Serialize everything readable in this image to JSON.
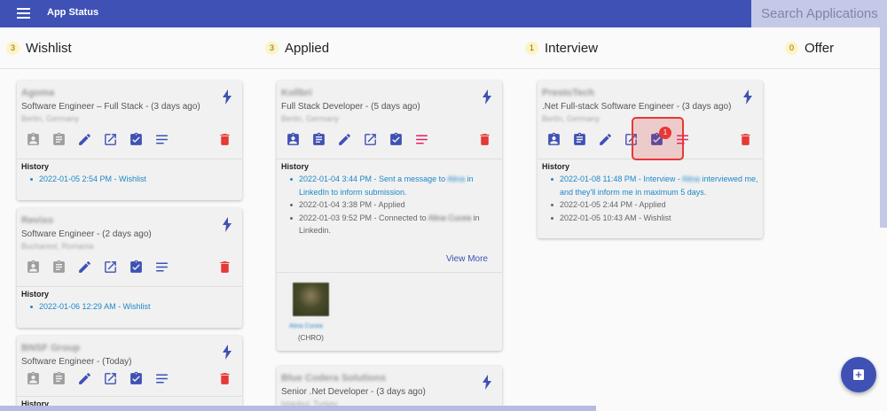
{
  "app": {
    "title": "App Status",
    "search_placeholder": "Search Applications"
  },
  "columns": [
    {
      "count": "3",
      "title": "Wishlist"
    },
    {
      "count": "3",
      "title": "Applied"
    },
    {
      "count": "1",
      "title": "Interview"
    },
    {
      "count": "0",
      "title": "Offer"
    }
  ],
  "history_label": "History",
  "colors": {
    "primary": "#3f51b5",
    "delete": "#e53935",
    "inactive_icon": "#9e9e9e",
    "notes_pink": "#e91e63",
    "history_link": "#1e88c8"
  },
  "wishlist": [
    {
      "company": "Agoma",
      "role": "Software Engineer – Full Stack - (3 days ago)",
      "location": "Berlin, Germany",
      "history": [
        {
          "text": "2022-01-05 2:54 PM - Wishlist"
        }
      ]
    },
    {
      "company": "Revixo",
      "role": "Software Engineer - (2 days ago)",
      "location": "Bucharest, Romania",
      "history": [
        {
          "text": "2022-01-06 12:29 AM - Wishlist"
        }
      ]
    },
    {
      "company": "BNSF Group",
      "role": "Software Engineer - (Today)",
      "location": "",
      "history": []
    }
  ],
  "applied": [
    {
      "company": "Kollbri",
      "role": "Full Stack Developer - (5 days ago)",
      "location": "Berlin, Germany",
      "history": [
        {
          "pre": "2022-01-04 3:44 PM - Sent a message to",
          "name": "Alina",
          "post": "in LinkedIn to inform submission."
        },
        {
          "text": "2022-01-04 3:38 PM - Applied"
        },
        {
          "pre": "2022-01-03 9:52 PM - Connected to",
          "name": "Alina Cucea",
          "post": "in Linkedin."
        }
      ],
      "view_more": "View More",
      "contact": {
        "name": "Alina Cucea",
        "role": "(CHRO)"
      }
    },
    {
      "company": "Blue Codera Solutions",
      "role": "Senior .Net Developer - (3 days ago)",
      "location": "Istanbul, Turkey"
    }
  ],
  "interview": [
    {
      "company": "PrestoTech",
      "role": ".Net Full-stack Software Engineer - (3 days ago)",
      "location": "Berlin, Germany",
      "badge": "1",
      "history": [
        {
          "pre": "2022-01-08 11:48 PM - Interview -",
          "name": "Alina",
          "post": "interviewed me, and they'll inform me in maximum 5 days."
        },
        {
          "text": "2022-01-05 2:44 PM - Applied"
        },
        {
          "text": "2022-01-05 10:43 AM - Wishlist"
        }
      ]
    }
  ]
}
